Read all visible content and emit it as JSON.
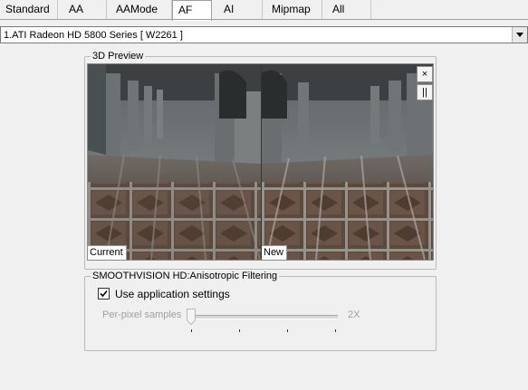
{
  "tabs": [
    {
      "label": "Standard",
      "active": false
    },
    {
      "label": "AA",
      "active": false
    },
    {
      "label": "AAMode",
      "active": false
    },
    {
      "label": "AF",
      "active": true
    },
    {
      "label": "AI",
      "active": false
    },
    {
      "label": "Mipmap",
      "active": false
    },
    {
      "label": "All",
      "active": false
    }
  ],
  "adapter": {
    "selected": "1.ATI Radeon HD 5800 Series [ W2261 ]"
  },
  "preview": {
    "title": "3D Preview",
    "current_label": "Current",
    "new_label": "New",
    "close_button": "×",
    "pause_button": "||"
  },
  "anisotropic": {
    "title": "SMOOTHVISION HD:Anisotropic Filtering",
    "use_app_settings_label": "Use application settings",
    "use_app_settings_checked": true,
    "slider_label": "Per-pixel samples",
    "slider_value": "2X",
    "slider_position_index": 0,
    "slider_tick_count": 4,
    "slider_enabled": false
  },
  "colors": {
    "window_bg": "#f0f0f0",
    "disabled_text": "#a0a0a0"
  }
}
